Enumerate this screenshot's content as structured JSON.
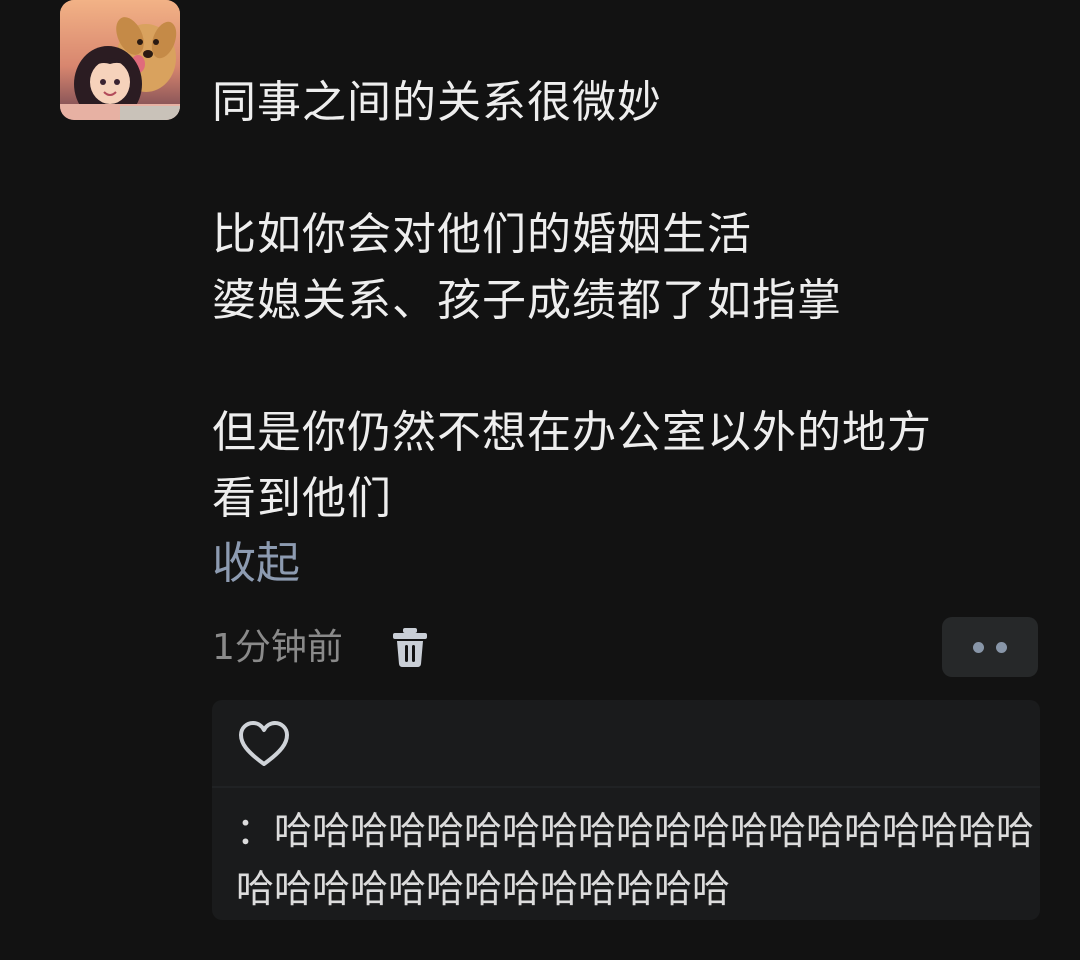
{
  "post": {
    "author_avatar": "avatar-girl-with-dog",
    "text": "同事之间的关系很微妙\n\n比如你会对他们的婚姻生活\n婆媳关系、孩子成绩都了如指掌\n\n但是你仍然不想在办公室以外的地方\n看到他们",
    "collapse_label": "收起",
    "timestamp": "1分钟前",
    "delete_icon": "trash-icon",
    "more_icon": "more-dots-icon"
  },
  "reply": {
    "like_icon": "heart-outline-icon",
    "text": "：哈哈哈哈哈哈哈哈哈哈哈哈哈哈哈哈哈哈哈哈哈哈哈哈哈哈哈哈哈哈哈哈哈"
  },
  "colors": {
    "background": "#121212",
    "link": "#8d9bb1",
    "muted_text": "#8a8a8a",
    "primary_text": "#eeeeee",
    "reply_background": "#1a1b1c"
  }
}
